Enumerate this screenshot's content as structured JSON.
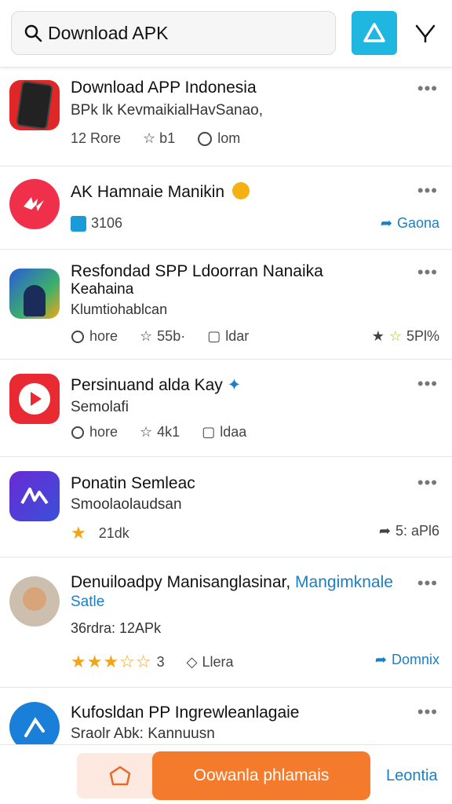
{
  "search": {
    "query": "Download APK"
  },
  "items": [
    {
      "title": "Download APP Indonesia",
      "subtitle": "BPk lk  KevmaikialHavSanao,",
      "meta": [
        "12 Rore",
        "☆ b1",
        "lom"
      ]
    },
    {
      "title": "AK Hamnaie Manikin",
      "meta": [
        "3106"
      ],
      "right": "Gaona"
    },
    {
      "title": "Resfondad SPP Ldoorran Nanaika",
      "title2": "Keahaina",
      "subtitle": "Klumtiohabl​can",
      "meta": [
        "hore",
        "55b·",
        "ldar"
      ],
      "right": "5Pl%"
    },
    {
      "title": "Persinuand alda Kay",
      "subtitle": "Semolafi",
      "meta": [
        "hore",
        "4k1",
        "ldaa"
      ]
    },
    {
      "title": "Ponatin Semleac",
      "subtitle": "Smoolaolaudsan",
      "meta": [
        "21dk"
      ],
      "right": "5: aPl6"
    },
    {
      "title_main": "Denuiloadpy",
      "title_mid": "Manisanglasinar,",
      "title_blue": "Mangimknale",
      "title_blue2": "Satle",
      "subtitle": "36rdra: 12APk",
      "meta": [
        "3",
        "Llera"
      ],
      "right": "Domnix"
    },
    {
      "title": "Kufosldan PP Ingrewleanlagaie",
      "subtitle": "Sraolr Abk: Kannuusn"
    }
  ],
  "bottom": {
    "cta": "Oowanla phlamais",
    "link": "Leontia"
  },
  "colors": {
    "accent_cyan": "#1fb7e0",
    "accent_orange": "#f47a2c",
    "link_blue": "#1a7fc6"
  }
}
